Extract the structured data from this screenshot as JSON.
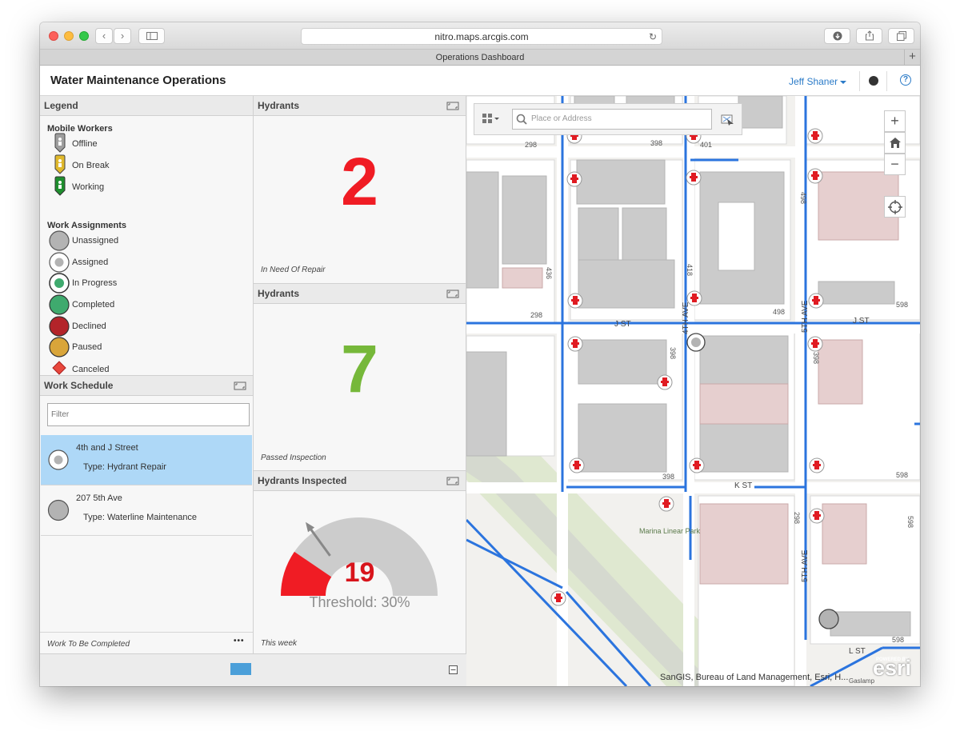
{
  "browser": {
    "url": "nitro.maps.arcgis.com",
    "tab_title": "Operations Dashboard"
  },
  "app": {
    "title": "Water Maintenance Operations",
    "user": "Jeff Shaner",
    "help": "?"
  },
  "legend": {
    "title": "Legend",
    "mobile_workers_heading": "Mobile Workers",
    "mobile_workers": [
      {
        "label": "Offline",
        "color": "#9e9e9e"
      },
      {
        "label": "On Break",
        "color": "#e0b92c"
      },
      {
        "label": "Working",
        "color": "#1e8f2e"
      }
    ],
    "work_assignments_heading": "Work Assignments",
    "work_assignments": [
      {
        "label": "Unassigned",
        "color": "#b3b3b3"
      },
      {
        "label": "Assigned",
        "color": "#ffffff"
      },
      {
        "label": "In Progress",
        "color": "#ffffff"
      },
      {
        "label": "Completed",
        "color": "#3faa6e"
      },
      {
        "label": "Declined",
        "color": "#b3242a"
      },
      {
        "label": "Paused",
        "color": "#d9a53a"
      },
      {
        "label": "Canceled",
        "color": "#e8473c"
      }
    ]
  },
  "work_schedule": {
    "title": "Work Schedule",
    "filter_placeholder": "Filter",
    "items": [
      {
        "name": "4th and J Street",
        "type": "Type: Hydrant Repair",
        "selected": true
      },
      {
        "name": "207 5th Ave",
        "type": "Type: Waterline Maintenance",
        "selected": false
      }
    ],
    "footer": "Work To Be Completed",
    "more": "•••"
  },
  "hydrants_repair": {
    "title": "Hydrants",
    "value": "2",
    "color": "#f01c24",
    "caption": "In Need Of Repair"
  },
  "hydrants_passed": {
    "title": "Hydrants",
    "value": "7",
    "color": "#76b83a",
    "caption": "Passed Inspection"
  },
  "hydrants_inspected": {
    "title": "Hydrants Inspected",
    "value": "19",
    "threshold": "Threshold: 30%",
    "caption": "This week",
    "gauge_fraction": 0.19,
    "threshold_fraction": 0.3,
    "fill_color": "#f01c24",
    "track_color": "#cccccc"
  },
  "map": {
    "search_placeholder": "Place or Address",
    "zoom_in": "+",
    "zoom_out": "−",
    "attribution": "SanGIS, Bureau of Land Management, Esri, H...",
    "logo_text": "esri",
    "powered_by": "POWERED BY",
    "street_labels": [
      "J ST",
      "J ST",
      "K ST",
      "L ST",
      "4TH AVE",
      "5TH AVE",
      "5TH AVE",
      "Marina Linear Park",
      "Gaslamp"
    ],
    "block_numbers": [
      "298",
      "398",
      "401",
      "498",
      "436",
      "418",
      "498",
      "298",
      "398",
      "398",
      "398",
      "598",
      "598",
      "298",
      "598",
      "598"
    ]
  }
}
